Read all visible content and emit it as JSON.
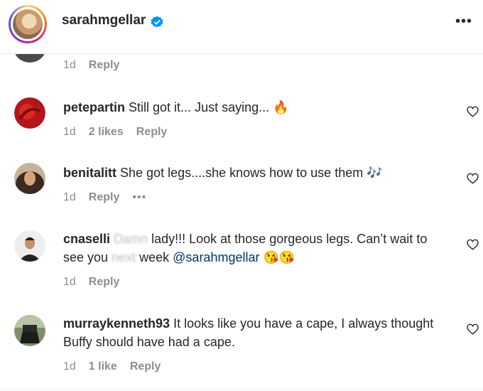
{
  "header": {
    "username": "sarahmgellar",
    "more_icon": "more-horizontal-icon"
  },
  "first_meta": {
    "time": "1d",
    "reply": "Reply"
  },
  "comments": [
    {
      "user": "petepartin",
      "text": "Still got it... Just saying... 🔥",
      "time": "1d",
      "likes": "2 likes",
      "reply": "Reply"
    },
    {
      "user": "benitalitt",
      "text": "She got legs....she knows how to use them 🎶",
      "time": "1d",
      "reply": "Reply",
      "more": "•••"
    },
    {
      "user": "cnaselli",
      "obscured": "Damn",
      "text1": "lady!!! Look at those gorgeous legs. Can’t wait to see you",
      "obscured2": "next",
      "text2": "week",
      "mention": "@sarahmgellar",
      "emoji": "😘😘",
      "time": "1d",
      "reply": "Reply"
    },
    {
      "user": "murraykenneth93",
      "text": "It looks like you have a cape, I always thought Buffy should have had a cape.",
      "time": "1d",
      "likes": "1 like",
      "reply": "Reply"
    }
  ]
}
